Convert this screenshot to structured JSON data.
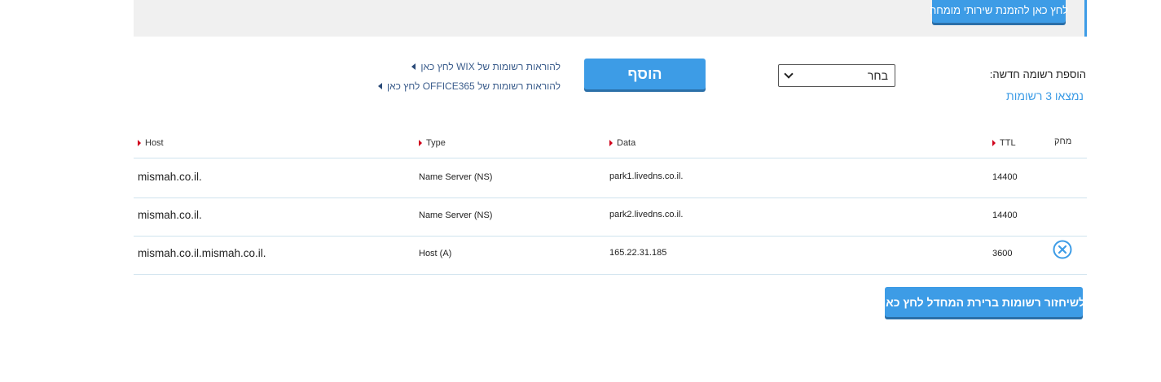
{
  "top": {
    "expert_button": "לחץ כאן להזמנת שירותי מומחה"
  },
  "add_record": {
    "label": "הוספת רשומה חדשה:",
    "select_value": "בחר",
    "add_button": "הוסף",
    "wix_link": "להוראות רשומות של WIX לחץ כאן",
    "office_link": "להוראות רשומות של OFFICE365 לחץ כאן",
    "found_text": "נמצאו 3 רשומות"
  },
  "table": {
    "headers": {
      "host": "Host",
      "type": "Type",
      "data": "Data",
      "ttl": "TTL",
      "delete": "מחק"
    },
    "rows": [
      {
        "host": "mismah.co.il.",
        "type": "Name Server (NS)",
        "data": "park1.livedns.co.il.",
        "ttl": "14400",
        "deletable": false
      },
      {
        "host": "mismah.co.il.",
        "type": "Name Server (NS)",
        "data": "park2.livedns.co.il.",
        "ttl": "14400",
        "deletable": false
      },
      {
        "host": "mismah.co.il.mismah.co.il.",
        "type": "Host (A)",
        "data": "165.22.31.185",
        "ttl": "3600",
        "deletable": true
      }
    ]
  },
  "restore_button": "לשיחזור רשומות ברירת המחדל לחץ כאן",
  "colors": {
    "accent": "#3d9ce6",
    "sort_arrow": "#d0021b",
    "link": "#3b5d8c"
  }
}
